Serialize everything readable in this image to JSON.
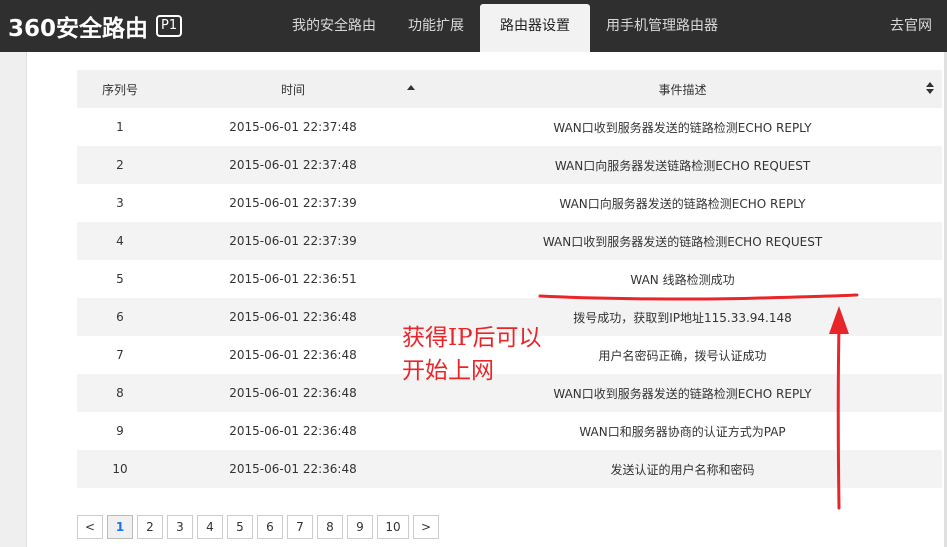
{
  "header": {
    "logo_text": "360安全路由",
    "logo_badge": "P1",
    "nav": [
      "我的安全路由",
      "功能扩展",
      "路由器设置",
      "用手机管理路由器"
    ],
    "active_nav": "路由器设置",
    "official_link": "去官网"
  },
  "table": {
    "columns": [
      "序列号",
      "时间",
      "事件描述"
    ],
    "rows": [
      {
        "id": "1",
        "time": "2015-06-01 22:37:48",
        "desc": "WAN口收到服务器发送的链路检测ECHO REPLY"
      },
      {
        "id": "2",
        "time": "2015-06-01 22:37:48",
        "desc": "WAN口向服务器发送链路检测ECHO REQUEST"
      },
      {
        "id": "3",
        "time": "2015-06-01 22:37:39",
        "desc": "WAN口向服务器发送的链路检测ECHO REPLY"
      },
      {
        "id": "4",
        "time": "2015-06-01 22:37:39",
        "desc": "WAN口收到服务器发送的链路检测ECHO REQUEST"
      },
      {
        "id": "5",
        "time": "2015-06-01 22:36:51",
        "desc": "WAN 线路检测成功"
      },
      {
        "id": "6",
        "time": "2015-06-01 22:36:48",
        "desc": "拨号成功，获取到IP地址115.33.94.148"
      },
      {
        "id": "7",
        "time": "2015-06-01 22:36:48",
        "desc": "用户名密码正确，拨号认证成功"
      },
      {
        "id": "8",
        "time": "2015-06-01 22:36:48",
        "desc": "WAN口收到服务器发送的链路检测ECHO REPLY"
      },
      {
        "id": "9",
        "time": "2015-06-01 22:36:48",
        "desc": "WAN口和服务器协商的认证方式为PAP"
      },
      {
        "id": "10",
        "time": "2015-06-01 22:36:48",
        "desc": "发送认证的用户名称和密码"
      }
    ]
  },
  "pagination": {
    "prev": "<",
    "pages": [
      "1",
      "2",
      "3",
      "4",
      "5",
      "6",
      "7",
      "8",
      "9",
      "10"
    ],
    "current": "1",
    "next": ">"
  },
  "annotation": {
    "line1": "获得IP后可以",
    "line2": "开始上网",
    "color": "#e8262a"
  },
  "colors": {
    "topbar": "#2f2f2f",
    "row_alt": "#f3f3f3",
    "active_page": "#1a73e8"
  }
}
